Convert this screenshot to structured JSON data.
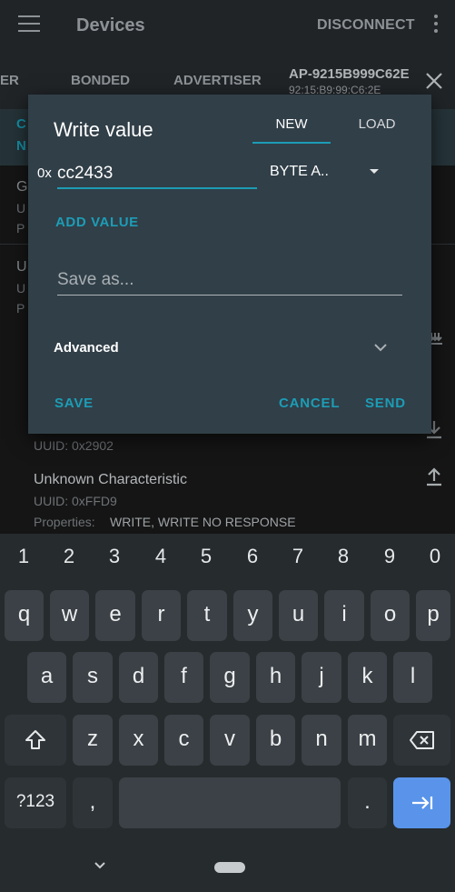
{
  "appbar": {
    "title": "Devices",
    "disconnect_label": "DISCONNECT",
    "tabs": [
      {
        "label": "ER"
      },
      {
        "label": "BONDED"
      },
      {
        "label": "ADVERTISER"
      }
    ],
    "active_device_tab": {
      "name": "AP-9215B999C62E",
      "mac": "92:15:B9:99:C6:2E"
    },
    "strip_letters": [
      "C",
      "N"
    ]
  },
  "background_list": {
    "partial_rows": [
      {
        "line1": "G",
        "line2": "U",
        "line3": "P"
      },
      {
        "line1": "U",
        "line2": "U",
        "line3": "P"
      }
    ],
    "descriptor_uuid": "UUID: 0x2902",
    "characteristic": {
      "name": "Unknown Characteristic",
      "uuid": "UUID: 0xFFD9",
      "properties_label": "Properties:",
      "properties_value": "WRITE, WRITE NO RESPONSE"
    }
  },
  "dialog": {
    "title": "Write value",
    "tabs": {
      "new": "NEW",
      "load": "LOAD",
      "active": "NEW"
    },
    "hex_prefix": "0x",
    "value": "cc2433",
    "format": "BYTE A..",
    "add_value_label": "ADD VALUE",
    "save_as_placeholder": "Save as...",
    "advanced_label": "Advanced",
    "buttons": {
      "save": "SAVE",
      "cancel": "CANCEL",
      "send": "SEND"
    },
    "accent_color": "#1c9db6"
  },
  "keyboard": {
    "number_row": [
      "1",
      "2",
      "3",
      "4",
      "5",
      "6",
      "7",
      "8",
      "9",
      "0"
    ],
    "row1": [
      "q",
      "w",
      "e",
      "r",
      "t",
      "y",
      "u",
      "i",
      "o",
      "p"
    ],
    "row2": [
      "a",
      "s",
      "d",
      "f",
      "g",
      "h",
      "j",
      "k",
      "l"
    ],
    "row3": [
      "z",
      "x",
      "c",
      "v",
      "b",
      "n",
      "m"
    ],
    "symbols_key": "?123",
    "comma_key": ",",
    "period_key": ".",
    "shift_icon": "shift-icon",
    "backspace_icon": "backspace-icon",
    "enter_icon": "next-field-icon"
  }
}
